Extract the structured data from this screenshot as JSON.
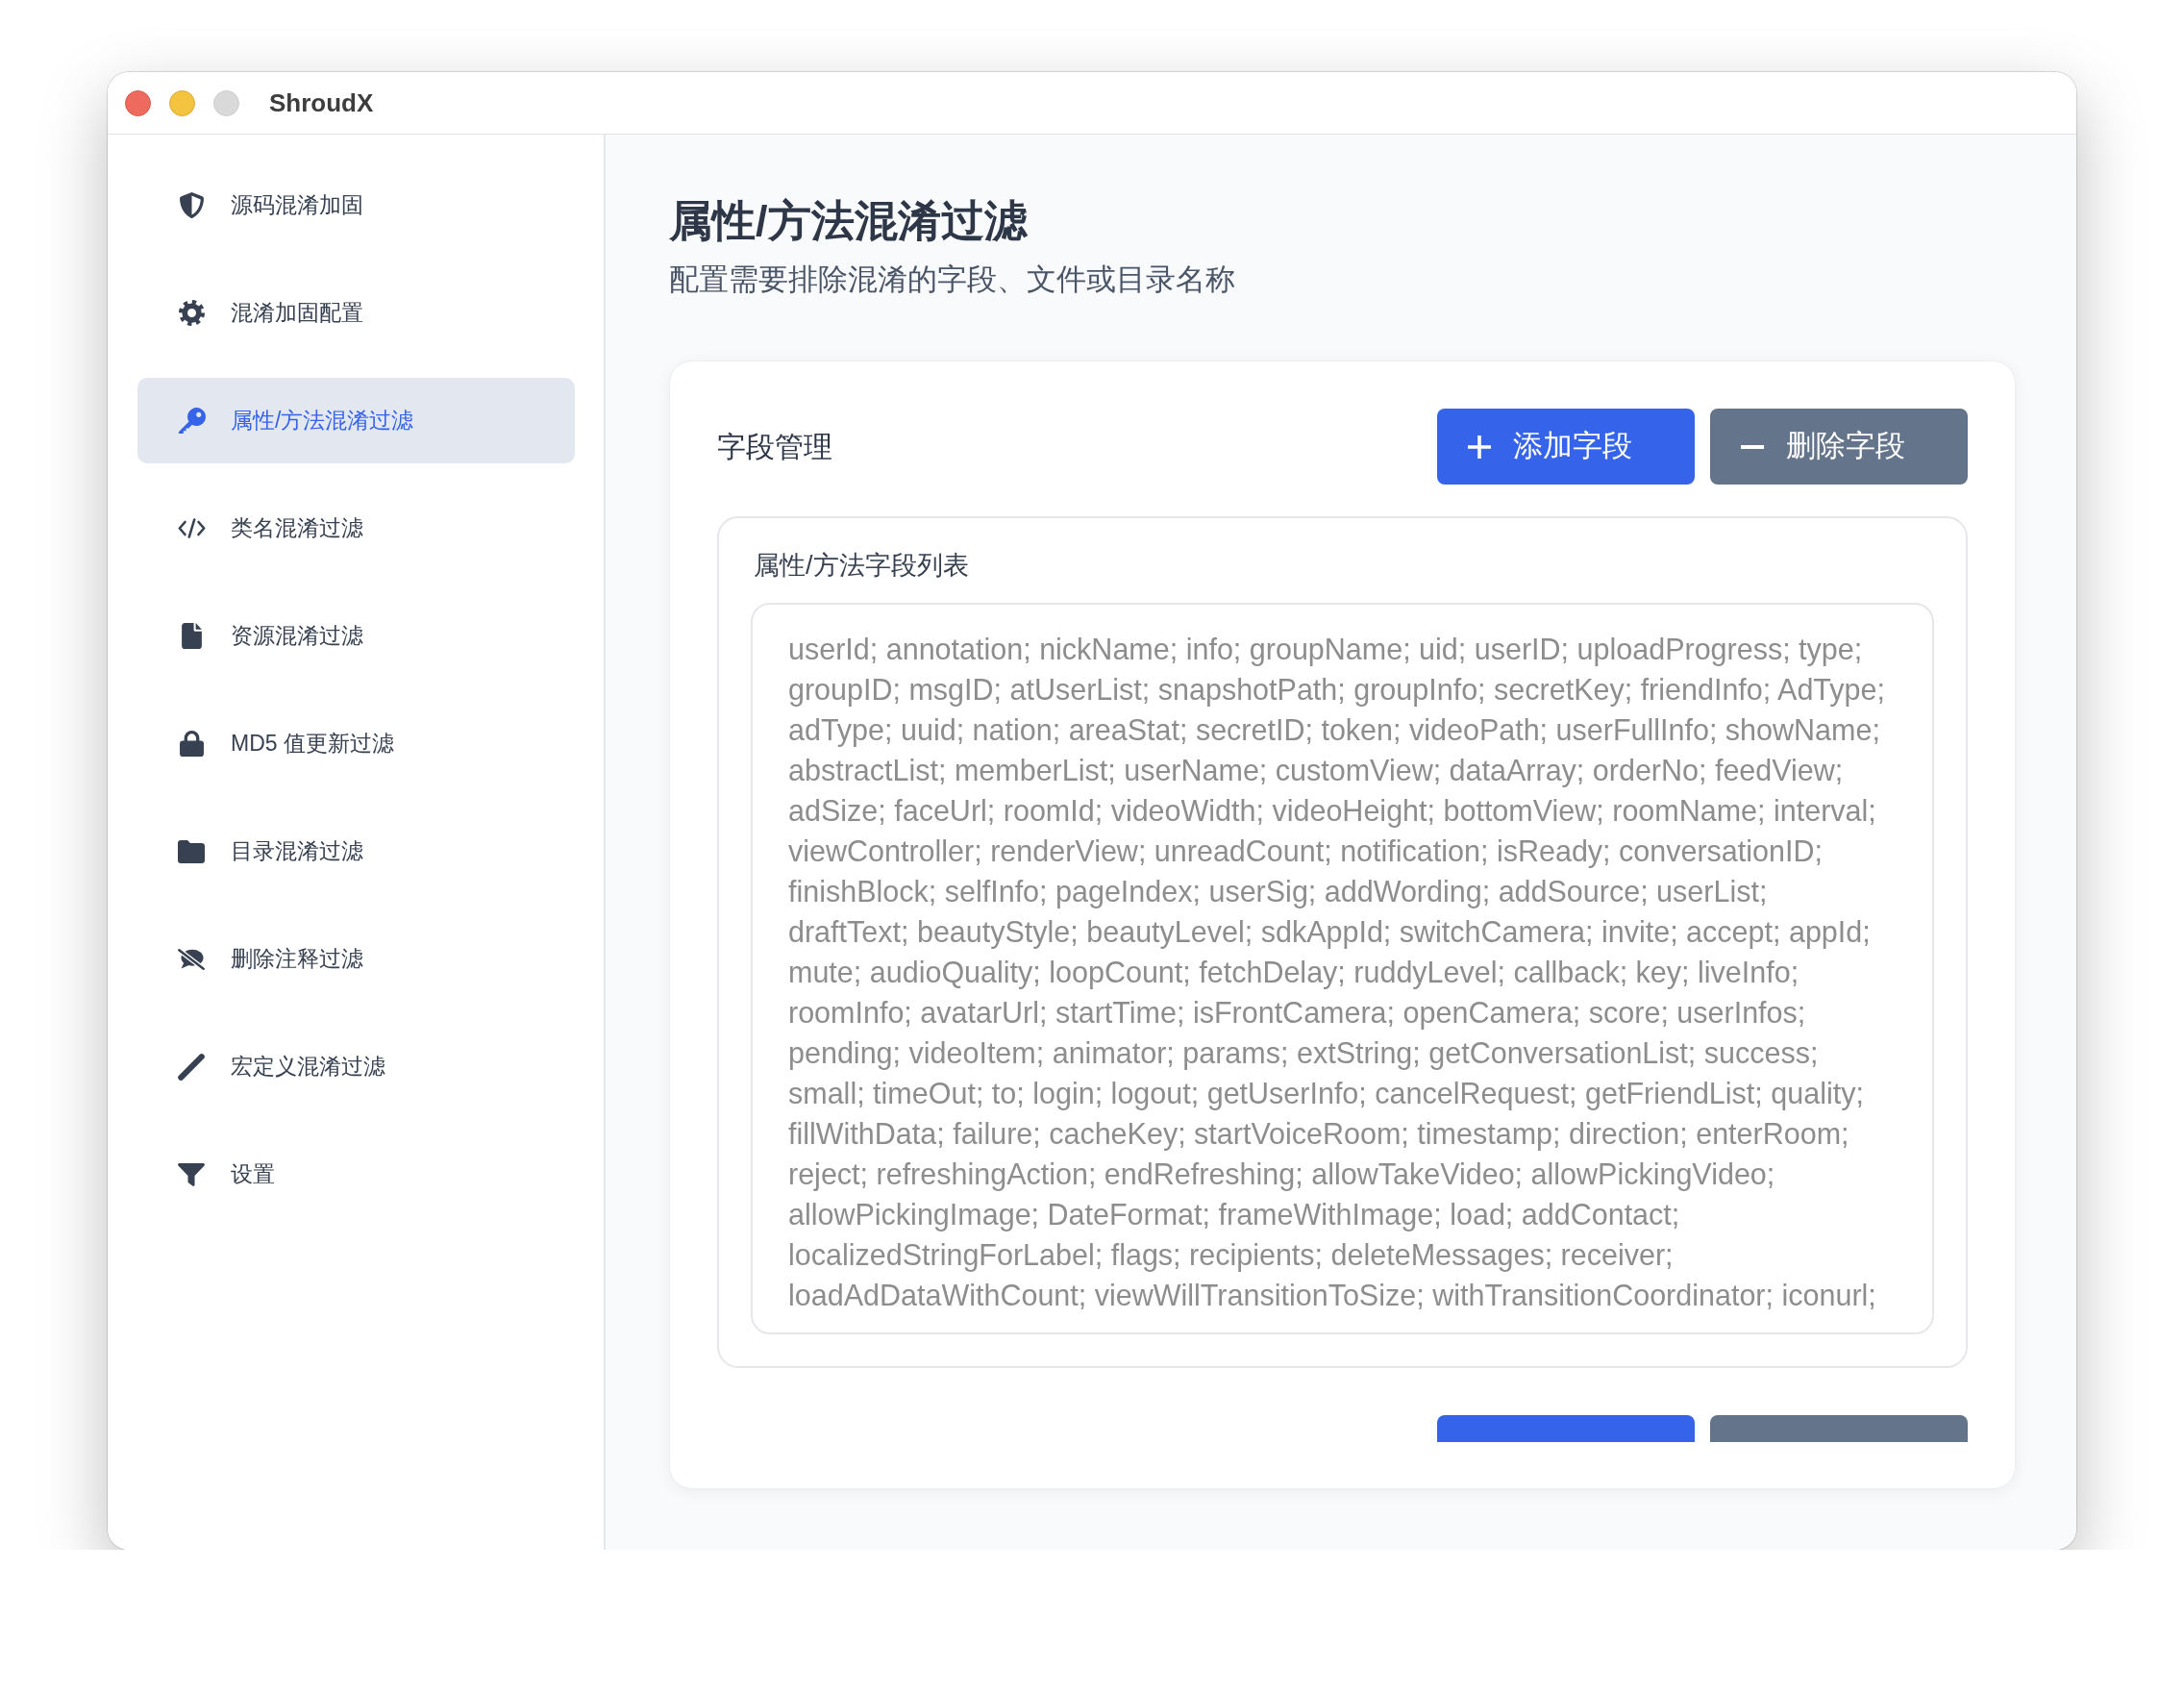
{
  "window": {
    "title": "ShroudX",
    "controls": [
      {
        "kind": "close",
        "disabled": false
      },
      {
        "kind": "minimize",
        "disabled": false
      },
      {
        "kind": "zoom",
        "disabled": true
      }
    ]
  },
  "sidebar": {
    "items": [
      {
        "label": "源码混淆加固",
        "selected": false
      },
      {
        "label": "混淆加固配置",
        "selected": false
      },
      {
        "label": "属性/方法混淆过滤",
        "selected": true
      },
      {
        "label": "类名混淆过滤",
        "selected": false
      },
      {
        "label": "资源混淆过滤",
        "selected": false
      },
      {
        "label": "MD5 值更新过滤",
        "selected": false
      },
      {
        "label": "目录混淆过滤",
        "selected": false
      },
      {
        "label": "删除注释过滤",
        "selected": false
      },
      {
        "label": "宏定义混淆过滤",
        "selected": false
      },
      {
        "label": "设置",
        "selected": false
      }
    ]
  },
  "header": {
    "title": "属性/方法混淆过滤",
    "subtitle": "配置需要排除混淆的字段、文件或目录名称"
  },
  "card": {
    "title": "字段管理",
    "buttons": [
      {
        "label": "添加字段",
        "kind": "add"
      },
      {
        "label": "删除字段",
        "kind": "remove"
      }
    ],
    "list": {
      "label": "属性/方法字段列表",
      "disabled": true,
      "value": "userId; annotation; nickName; info; groupName; uid; userID; uploadProgress; type;\ngroupID; msgID; atUserList; snapshotPath; groupInfo; secretKey; friendInfo; AdType;\nadType; uuid; nation; areaStat; secretID; token; videoPath; userFullInfo; showName;\nabstractList; memberList; userName; customView; dataArray; orderNo; feedView;\nadSize; faceUrl; roomId; videoWidth; videoHeight; bottomView; roomName; interval;\nviewController; renderView; unreadCount; notification; isReady; conversationID;\nfinishBlock; selfInfo; pageIndex; userSig; addWording; addSource; userList;\ndraftText; beautyStyle; beautyLevel; sdkAppId; switchCamera; invite; accept; appId;\nmute; audioQuality; loopCount; fetchDelay; ruddyLevel; callback; key; liveInfo;\nroomInfo; avatarUrl; startTime; isFrontCamera; openCamera; score; userInfos;\npending; videoItem; animator; params; extString; getConversationList; success;\nsmall; timeOut; to; login; logout; getUserInfo; cancelRequest; getFriendList; quality;\nfillWithData; failure; cacheKey; startVoiceRoom; timestamp; direction; enterRoom;\nreject; refreshingAction; endRefreshing; allowTakeVideo; allowPickingVideo;\nallowPickingImage; DateFormat; frameWithImage; load; addContact;\nlocalizedStringForLabel; flags; recipients; deleteMessages; receiver;\nloadAdDataWithCount; viewWillTransitionToSize; withTransitionCoordinator; iconurl;"
    },
    "more_buttons": [
      {
        "kind": "add"
      },
      {
        "kind": "remove"
      }
    ]
  }
}
